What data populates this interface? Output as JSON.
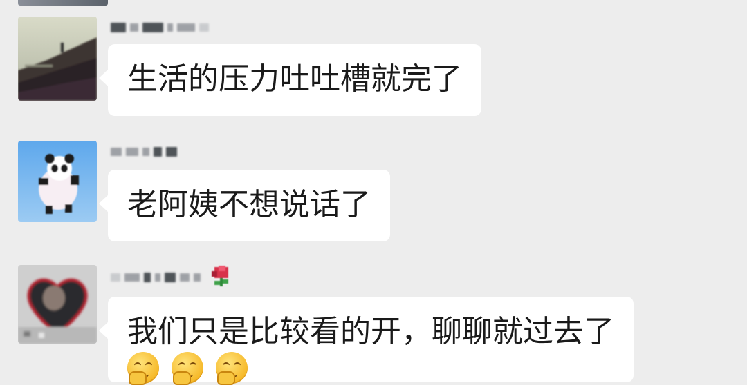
{
  "chat": {
    "messages": [
      {
        "sender_name": "",
        "text": "生活的压力吐吐槽就完了",
        "emojis": []
      },
      {
        "sender_name": "",
        "text": "老阿姨不想说话了",
        "emojis": []
      },
      {
        "sender_name": "",
        "text": "我们只是比较看的开，聊聊就过去了",
        "emojis": [
          "embarrassed-smile-icon",
          "embarrassed-smile-icon",
          "embarrassed-smile-icon"
        ]
      }
    ]
  },
  "colors": {
    "background": "#ededed",
    "bubble": "#ffffff",
    "text": "#1a1a1a",
    "name_placeholder": "#9ea1a6"
  }
}
